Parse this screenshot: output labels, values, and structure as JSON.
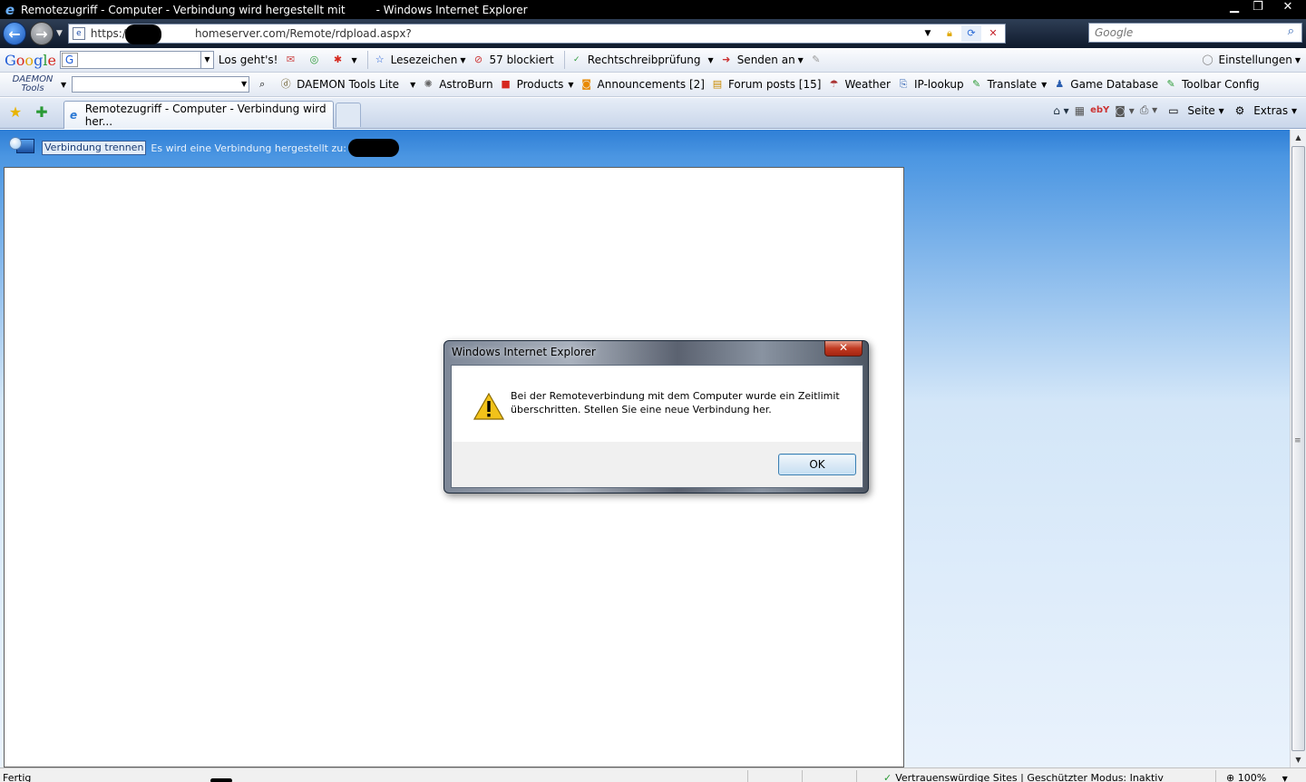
{
  "window": {
    "title": "Remotezugriff - Computer - Verbindung wird hergestellt mit ",
    "title_suffix": "- Windows Internet Explorer",
    "controls": [
      "minimize",
      "restore",
      "close"
    ]
  },
  "address_bar": {
    "url_prefix": "https://",
    "url_suffix": "homeserver.com/Remote/rdpload.aspx?",
    "search_placeholder": "Google"
  },
  "google_toolbar": {
    "go_label": "Los geht's!",
    "bookmarks_label": "Lesezeichen",
    "blocked_label": "57 blockiert",
    "spellcheck_label": "Rechtschreibprüfung",
    "send_label": "Senden an",
    "settings_label": "Einstellungen"
  },
  "daemon_toolbar": {
    "logo_line1": "DAEMON",
    "logo_line2": "Tools",
    "items": [
      {
        "label": "DAEMON Tools Lite",
        "icon": "daemon-icon",
        "dropdown": true
      },
      {
        "label": "AstroBurn",
        "icon": "astroburn-icon",
        "dropdown": false
      },
      {
        "label": "Products",
        "icon": "products-icon",
        "dropdown": true
      },
      {
        "label": "Announcements [2]",
        "icon": "rss-icon",
        "dropdown": false
      },
      {
        "label": "Forum posts [15]",
        "icon": "forum-icon",
        "dropdown": false
      },
      {
        "label": "Weather",
        "icon": "weather-icon",
        "dropdown": false
      },
      {
        "label": "IP-lookup",
        "icon": "ip-lookup-icon",
        "dropdown": false
      },
      {
        "label": "Translate",
        "icon": "translate-icon",
        "dropdown": true
      },
      {
        "label": "Game Database",
        "icon": "game-database-icon",
        "dropdown": false
      },
      {
        "label": "Toolbar Config",
        "icon": "toolbar-config-icon",
        "dropdown": false
      }
    ]
  },
  "tabs": {
    "active_label": "Remotezugriff - Computer - Verbindung wird her...",
    "command_page": "Seite",
    "command_extras": "Extras"
  },
  "rdp": {
    "disconnect_label": "Verbindung trennen",
    "status_text": "Es wird eine Verbindung hergestellt zu:"
  },
  "dialog": {
    "title": "Windows Internet Explorer",
    "message_line1": "Bei der Remoteverbindung mit dem Computer wurde ein Zeitlimit",
    "message_line2": "überschritten. Stellen Sie eine neue Verbindung her.",
    "ok_label": "OK"
  },
  "status_bar": {
    "text": "Fertig",
    "zone": "Vertrauenswürdige Sites | Geschützter Modus: Inaktiv",
    "zoom": "100%"
  },
  "colors": {
    "content_gradient_top": "#2f7fd6",
    "content_gradient_bottom": "#e9f2fc",
    "dialog_close": "#c13a22"
  }
}
